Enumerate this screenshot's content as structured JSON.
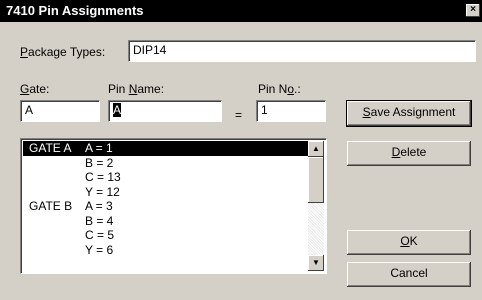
{
  "window": {
    "title": "7410 Pin Assignments",
    "close_glyph": "×"
  },
  "package": {
    "label_u": "P",
    "label_rest": "ackage Types:",
    "value": "DIP14"
  },
  "gate": {
    "label_u": "G",
    "label_rest": "ate:",
    "value": "A"
  },
  "pin_name": {
    "label_pre": "Pin ",
    "label_u": "N",
    "label_rest": "ame:",
    "value": "A"
  },
  "equals": "=",
  "pin_no": {
    "label_pre": "Pin N",
    "label_u": "o",
    "label_rest": ".:",
    "value": "1"
  },
  "buttons": {
    "save": {
      "u": "S",
      "rest": "ave Assignment"
    },
    "delete": {
      "u": "D",
      "rest": "elete"
    },
    "ok": {
      "u": "O",
      "rest": "K"
    },
    "cancel": {
      "label": "Cancel"
    }
  },
  "list": {
    "rows": [
      {
        "gate": "GATE A",
        "value": "A = 1",
        "selected": true
      },
      {
        "gate": "",
        "value": "B = 2"
      },
      {
        "gate": "",
        "value": "C = 13"
      },
      {
        "gate": "",
        "value": "Y = 12"
      },
      {
        "gate": "GATE B",
        "value": "A = 3"
      },
      {
        "gate": "",
        "value": "B = 4"
      },
      {
        "gate": "",
        "value": "C = 5"
      },
      {
        "gate": "",
        "value": "Y = 6"
      }
    ],
    "scroll_up_glyph": "▲",
    "scroll_down_glyph": "▼"
  }
}
